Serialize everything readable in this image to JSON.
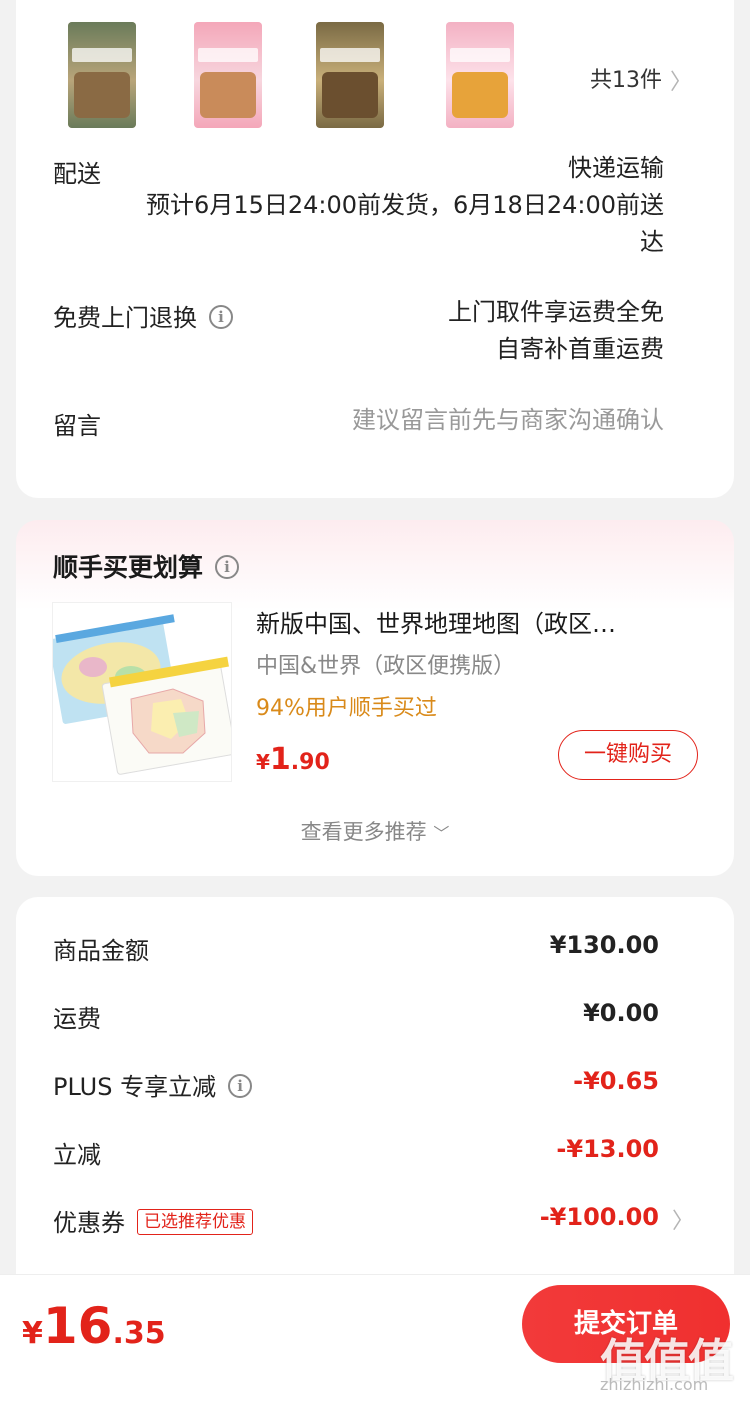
{
  "order_items": {
    "count_text": "共13件",
    "thumbnails": [
      {
        "label": "book-cover-1",
        "colors": [
          "#6a7b5a",
          "#b9a57a",
          "#8a6a44"
        ]
      },
      {
        "label": "book-cover-2",
        "colors": [
          "#f4a7b9",
          "#f7d6de",
          "#c98b5a"
        ]
      },
      {
        "label": "book-cover-3",
        "colors": [
          "#7a6a44",
          "#c9b07a",
          "#6b4f2f"
        ]
      },
      {
        "label": "book-cover-4",
        "colors": [
          "#f3b1c3",
          "#fde2ea",
          "#e7a33a"
        ]
      }
    ]
  },
  "delivery": {
    "label": "配送",
    "method": "快递运输",
    "estimate_line1": "预计6月15日24:00前发货，6月18日24:00前送",
    "estimate_line2": "达"
  },
  "return": {
    "label": "免费上门退换",
    "line1": "上门取件享运费全免",
    "line2": "自寄补首重运费"
  },
  "message": {
    "label": "留言",
    "placeholder": "建议留言前先与商家沟通确认"
  },
  "recommend": {
    "title": "顺手买更划算",
    "product": {
      "title": "新版中国、世界地理地图（政区…",
      "spec": "中国&世界（政区便携版）",
      "popularity": "94%用户顺手买过",
      "price_currency": "¥",
      "price_int": "1",
      "price_dec": ".90",
      "buy_label": "一键购买"
    },
    "more_label": "查看更多推荐"
  },
  "fees": {
    "goods_label": "商品金额",
    "goods_value": "¥130.00",
    "shipping_label": "运费",
    "shipping_value": "¥0.00",
    "plus_label": "PLUS 专享立减",
    "plus_value": "-¥0.65",
    "direct_label": "立减",
    "direct_value": "-¥13.00",
    "coupon_label": "优惠券",
    "coupon_tag": "已选推荐优惠",
    "coupon_value": "-¥100.00"
  },
  "bottom": {
    "currency": "¥",
    "total_int": "16",
    "total_dec": ".35",
    "submit_label": "提交订单"
  },
  "watermark": {
    "text": "值值值",
    "url": "zhizhizhi.com"
  },
  "colors": {
    "accent_red": "#e2231a",
    "popularity_orange": "#d98a1a"
  }
}
